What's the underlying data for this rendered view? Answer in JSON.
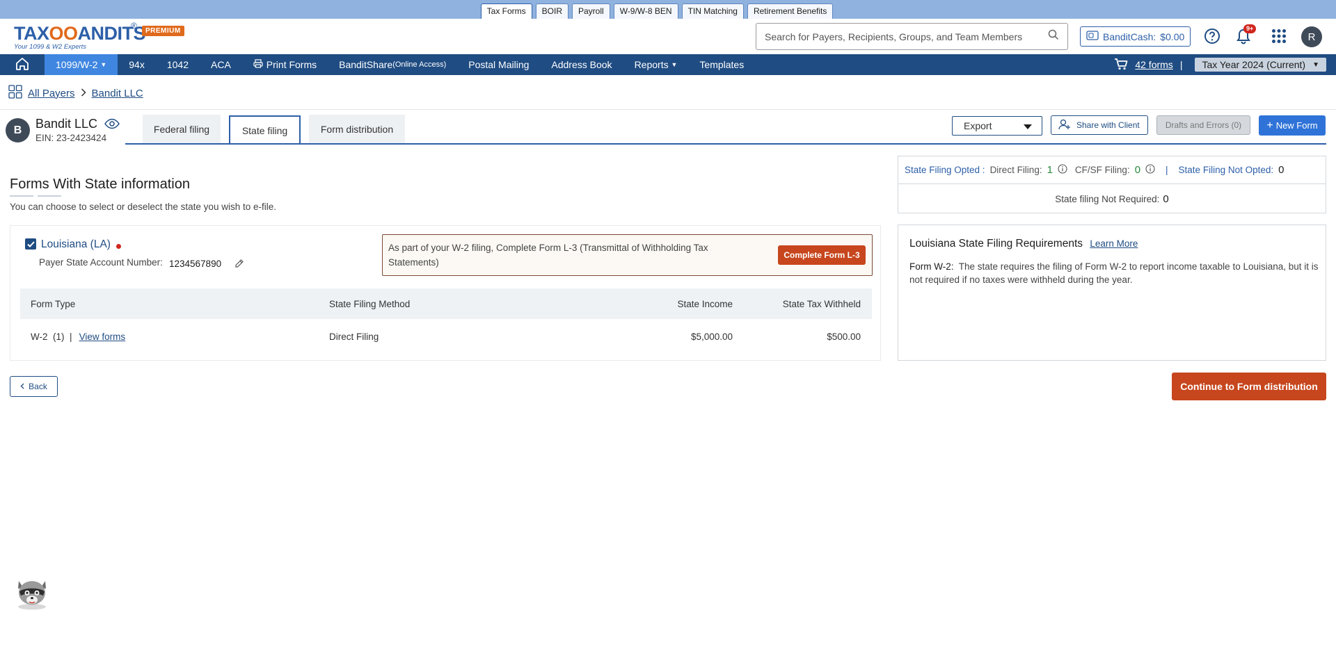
{
  "top_tabs": [
    "Tax Forms",
    "BOIR",
    "Payroll",
    "W-9/W-8 BEN",
    "TIN Matching",
    "Retirement Benefits"
  ],
  "active_top_tab": "Tax Forms",
  "logo": {
    "brand_left": "TAX",
    "brand_oo": "OO",
    "brand_right": "ANDITS",
    "reg": "®",
    "tagline": "Your 1099 & W2 Experts",
    "premium": "PREMIUM"
  },
  "search": {
    "placeholder": "Search for Payers, Recipients, Groups, and Team Members"
  },
  "bandit_cash": {
    "label": "BanditCash:",
    "amount": "$0.00"
  },
  "notifications": {
    "badge": "9+"
  },
  "user_initial": "R",
  "nav": {
    "items": [
      "1099/W-2",
      "94x",
      "1042",
      "ACA",
      "Print Forms",
      "BanditShare",
      "Postal Mailing",
      "Address Book",
      "Reports",
      "Templates"
    ],
    "banditshare_suffix": "(Online Access)",
    "forms_count": "42 forms",
    "divider": "|",
    "tax_year": "Tax Year 2024 (Current)"
  },
  "breadcrumb": {
    "all_payers": "All Payers",
    "payer": "Bandit LLC"
  },
  "payer": {
    "initial": "B",
    "name": "Bandit LLC",
    "ein": "EIN: 23-2423424"
  },
  "tabs": [
    "Federal filing",
    "State filing",
    "Form distribution"
  ],
  "actions": {
    "export": "Export",
    "share": "Share with Client",
    "drafts": "Drafts and Errors (0)",
    "new_form": "New Form"
  },
  "section": {
    "title": "Forms With State information",
    "subtitle": "You can choose to select or deselect the state you wish to e-file."
  },
  "state": {
    "name": "Louisiana (LA)",
    "checked": true,
    "account_label": "Payer State Account Number:",
    "account_number": "1234567890",
    "notice": "As part of your W-2 filing, Complete Form L-3 (Transmittal of Withholding Tax Statements)",
    "notice_button": "Complete Form L-3",
    "table": {
      "headers": [
        "Form Type",
        "State Filing Method",
        "State Income",
        "State Tax Withheld"
      ],
      "rows": [
        {
          "form": "W-2",
          "count": "(1)",
          "sep": "|",
          "link": "View forms",
          "method": "Direct Filing",
          "income": "$5,000.00",
          "withheld": "$500.00"
        }
      ]
    }
  },
  "stats": {
    "opted_label": "State Filing Opted :",
    "direct_label": "Direct Filing:",
    "direct_value": "1",
    "cfsf_label": "CF/SF Filing:",
    "cfsf_value": "0",
    "divider": "|",
    "not_opted_label": "State Filing Not Opted:",
    "not_opted_value": "0",
    "not_required_label": "State filing Not Required:",
    "not_required_value": "0"
  },
  "requirements": {
    "title": "Louisiana State Filing Requirements",
    "learn_more": "Learn More",
    "form_label": "Form W-2:",
    "text": "The state requires the filing of Form W-2 to report income taxable to Louisiana, but it is not required if no taxes were withheld during the year."
  },
  "buttons": {
    "back": "Back",
    "continue": "Continue to Form distribution"
  },
  "colors": {
    "nav": "#1f4c82",
    "nav_active": "#3f86e0",
    "accent": "#2d5fa8",
    "orange": "#c7461d",
    "topbar": "#8fb2de"
  }
}
